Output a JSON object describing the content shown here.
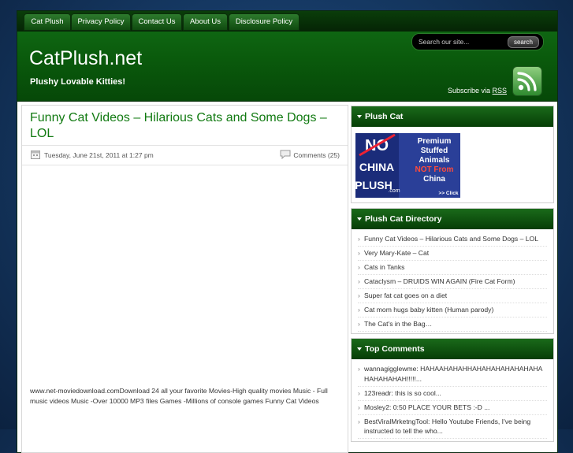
{
  "nav": {
    "items": [
      {
        "label": "Cat Plush"
      },
      {
        "label": "Privacy Policy"
      },
      {
        "label": "Contact Us"
      },
      {
        "label": "About Us"
      },
      {
        "label": "Disclosure Policy"
      }
    ]
  },
  "header": {
    "title": "CatPlush.net",
    "tagline": "Plushy Lovable Kitties!",
    "search_placeholder": "Search our site...",
    "search_button": "search",
    "subscribe_prefix": "Subscribe via",
    "subscribe_link": "RSS",
    "rss_icon": "rss-icon"
  },
  "post": {
    "title": "Funny Cat Videos – Hilarious Cats and Some Dogs – LOL",
    "date": "Tuesday, June 21st, 2011 at 1:27 pm",
    "comments": "Comments (25)",
    "body": "www.net-moviedownload.comDownload 24 all your favorite Movies-High quality movies Music - Full music videos Music -Over 10000 MP3 files Games -Millions of console games Funny Cat Videos"
  },
  "sidebar": {
    "plush_cat": {
      "title": "Plush Cat",
      "banner": {
        "left_text_1": "NO",
        "left_text_2": "CHINA",
        "left_text_3": "PLUSH",
        "left_text_4": ".com",
        "right_line_1": "Premium",
        "right_line_2": "Stuffed",
        "right_line_3": "Animals",
        "right_line_4": "NOT From",
        "right_line_5": "China",
        "click": ">> Click"
      }
    },
    "directory": {
      "title": "Plush Cat Directory",
      "items": [
        "Funny Cat Videos – Hilarious Cats and Some Dogs – LOL",
        "Very Mary-Kate – Cat",
        "Cats in Tanks",
        "Cataclysm – DRUIDS WIN AGAIN (Fire Cat Form)",
        "Super fat cat goes on a diet",
        "Cat mom hugs baby kitten (Human parody)",
        "The Cat's in the Bag…"
      ]
    },
    "top_comments": {
      "title": "Top Comments",
      "items": [
        "wannagigglewme: HAHAAHAHAHHAHAHAHAHAHAHAHAHAHAHAHAH!!!!!...",
        "123readr: this is so cool...",
        "Mosley2: 0:50 PLACE YOUR BETS :-D ...",
        "BestViralMrketngTool: Hello Youtube Friends, I've being instructed to tell the who..."
      ]
    }
  }
}
